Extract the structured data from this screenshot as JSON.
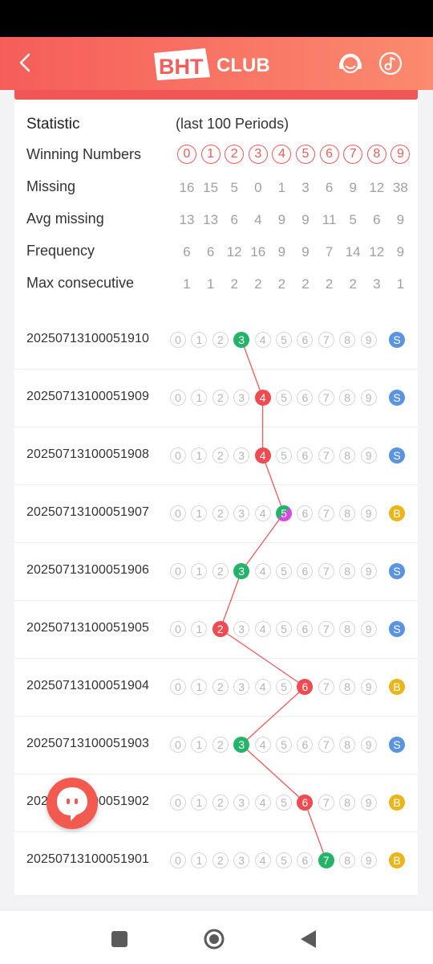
{
  "header": {
    "logo_text_1": "BHT",
    "logo_text_2": "CLUB"
  },
  "stats": {
    "title": "Statistic",
    "period_label": "(last 100 Periods)",
    "winning_label": "Winning Numbers",
    "numbers": [
      "0",
      "1",
      "2",
      "3",
      "4",
      "5",
      "6",
      "7",
      "8",
      "9"
    ],
    "rows": [
      {
        "label": "Missing",
        "values": [
          "16",
          "15",
          "5",
          "0",
          "1",
          "3",
          "6",
          "9",
          "12",
          "38"
        ]
      },
      {
        "label": "Avg missing",
        "values": [
          "13",
          "13",
          "6",
          "4",
          "9",
          "9",
          "11",
          "5",
          "6",
          "9"
        ]
      },
      {
        "label": "Frequency",
        "values": [
          "6",
          "6",
          "12",
          "16",
          "9",
          "9",
          "7",
          "14",
          "12",
          "9"
        ]
      },
      {
        "label": "Max consecutive",
        "values": [
          "1",
          "1",
          "2",
          "2",
          "2",
          "2",
          "2",
          "2",
          "3",
          "1"
        ]
      }
    ]
  },
  "trend": {
    "rows": [
      {
        "period": "20250713100051910",
        "hit": 3,
        "color": "green",
        "size": "S"
      },
      {
        "period": "20250713100051909",
        "hit": 4,
        "color": "red",
        "size": "S"
      },
      {
        "period": "20250713100051908",
        "hit": 4,
        "color": "red",
        "size": "S"
      },
      {
        "period": "20250713100051907",
        "hit": 5,
        "color": "violet",
        "size": "B"
      },
      {
        "period": "20250713100051906",
        "hit": 3,
        "color": "green",
        "size": "S"
      },
      {
        "period": "20250713100051905",
        "hit": 2,
        "color": "red",
        "size": "S"
      },
      {
        "period": "20250713100051904",
        "hit": 6,
        "color": "red",
        "size": "B"
      },
      {
        "period": "20250713100051903",
        "hit": 3,
        "color": "green",
        "size": "S"
      },
      {
        "period": "20250713100051902",
        "hit": 6,
        "color": "red",
        "size": "B"
      },
      {
        "period": "20250713100051901",
        "hit": 7,
        "color": "green",
        "size": "B"
      }
    ]
  },
  "colors": {
    "header_start": "#f65d5a",
    "header_end": "#fb8a6e",
    "red": "#ef4b50",
    "green": "#23b468",
    "violet": "#d54be0",
    "small_badge": "#5a93e0",
    "big_badge": "#eab51a",
    "trend_line": "#ef5a5a"
  },
  "icons": {
    "back": "chevron-left-icon",
    "support": "headset-icon",
    "sound": "music-note-icon",
    "float": "chat-bubble-icon",
    "nav": [
      "square-icon",
      "circle-icon",
      "triangle-back-icon"
    ]
  }
}
